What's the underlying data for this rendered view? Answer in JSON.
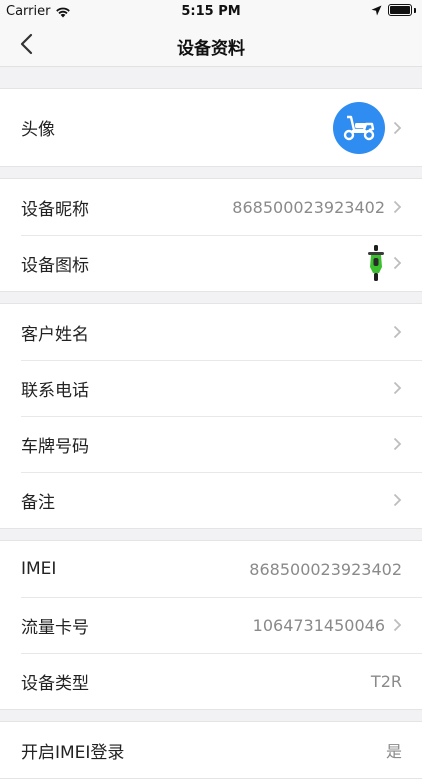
{
  "status": {
    "carrier": "Carrier",
    "time": "5:15 PM"
  },
  "nav": {
    "title": "设备资料"
  },
  "sections": {
    "profile": {
      "avatar_label": "头像"
    },
    "device": {
      "nickname_label": "设备昵称",
      "nickname_value": "868500023923402",
      "icon_label": "设备图标"
    },
    "customer": {
      "name_label": "客户姓名",
      "phone_label": "联系电话",
      "plate_label": "车牌号码",
      "note_label": "备注"
    },
    "info": {
      "imei_label": "IMEI",
      "imei_value": "868500023923402",
      "sim_label": "流量卡号",
      "sim_value": "1064731450046",
      "type_label": "设备类型",
      "type_value": "T2R"
    },
    "settings": {
      "imei_login_label": "开启IMEI登录",
      "imei_login_value": "是"
    }
  },
  "icons": {
    "avatar": "scooter-icon",
    "device_icon": "motorcycle-icon",
    "chevron": "chevron-right-icon"
  },
  "colors": {
    "accent": "#2f8cf0",
    "device_icon": "#3bbf2f"
  }
}
